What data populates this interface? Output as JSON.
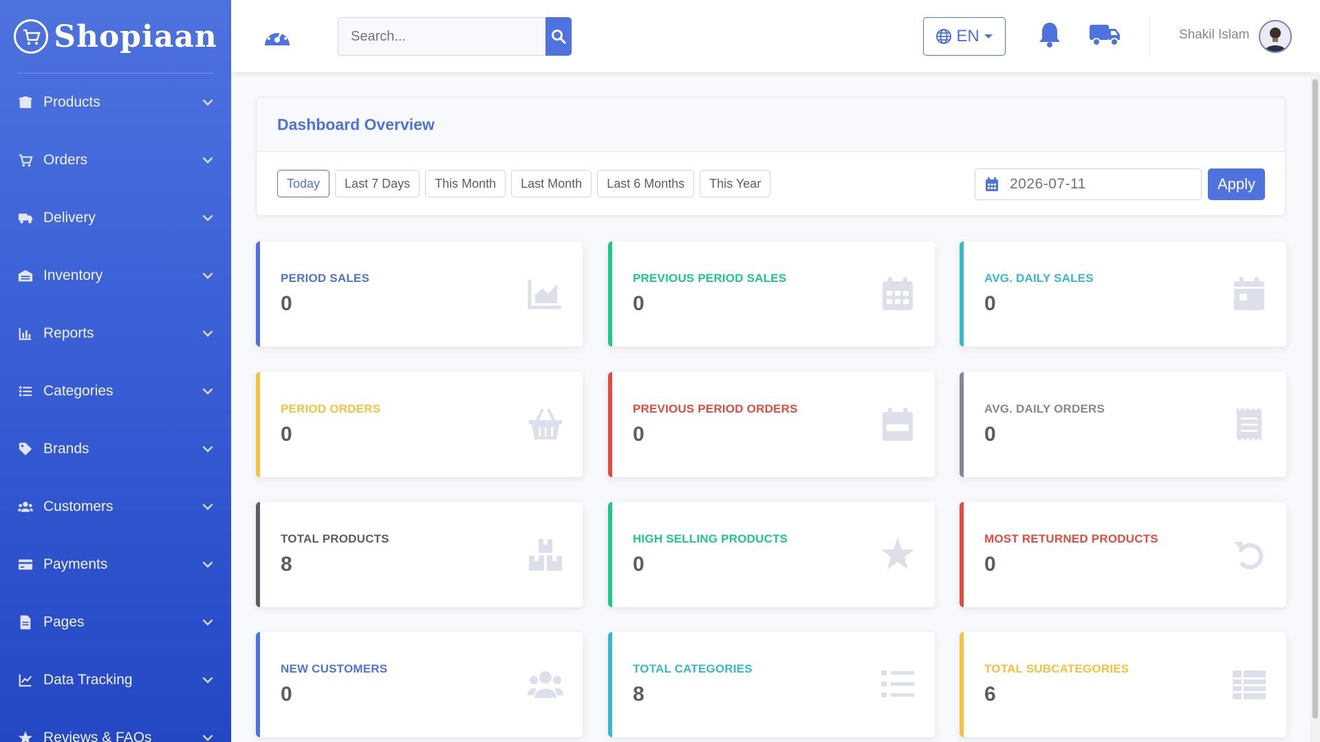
{
  "brand": {
    "name": "Shopiaan"
  },
  "sidebar": {
    "items": [
      {
        "label": "Products",
        "icon": "box-icon"
      },
      {
        "label": "Orders",
        "icon": "cart-icon"
      },
      {
        "label": "Delivery",
        "icon": "truck-icon"
      },
      {
        "label": "Inventory",
        "icon": "warehouse-icon"
      },
      {
        "label": "Reports",
        "icon": "bar-chart-icon"
      },
      {
        "label": "Categories",
        "icon": "list-icon"
      },
      {
        "label": "Brands",
        "icon": "tag-icon"
      },
      {
        "label": "Customers",
        "icon": "users-icon"
      },
      {
        "label": "Payments",
        "icon": "credit-card-icon"
      },
      {
        "label": "Pages",
        "icon": "file-icon"
      },
      {
        "label": "Data Tracking",
        "icon": "line-chart-icon"
      },
      {
        "label": "Reviews & FAQs",
        "icon": "star-icon"
      }
    ]
  },
  "topbar": {
    "search_placeholder": "Search...",
    "language": "EN",
    "user_name": "Shakil Islam"
  },
  "overview": {
    "title": "Dashboard Overview",
    "filters": [
      "Today",
      "Last 7 Days",
      "This Month",
      "Last Month",
      "Last 6 Months",
      "This Year"
    ],
    "active_filter": "Today",
    "date_value": "2026-07-11",
    "apply_label": "Apply"
  },
  "stats": [
    {
      "label": "PERIOD SALES",
      "value": "0",
      "color": "#4e73df",
      "icon": "chart-area-icon"
    },
    {
      "label": "PREVIOUS PERIOD SALES",
      "value": "0",
      "color": "#1cc88a",
      "icon": "calendar-grid-icon"
    },
    {
      "label": "AVG. DAILY SALES",
      "value": "0",
      "color": "#36b9cc",
      "icon": "calendar-day-icon"
    },
    {
      "label": "PERIOD ORDERS",
      "value": "0",
      "color": "#f6c23e",
      "icon": "basket-icon"
    },
    {
      "label": "PREVIOUS PERIOD ORDERS",
      "value": "0",
      "color": "#e74a3b",
      "icon": "calendar-week-icon"
    },
    {
      "label": "AVG. DAILY ORDERS",
      "value": "0",
      "color": "#858796",
      "icon": "receipt-icon"
    },
    {
      "label": "TOTAL PRODUCTS",
      "value": "8",
      "color": "#5a5c69",
      "icon": "boxes-icon"
    },
    {
      "label": "HIGH SELLING PRODUCTS",
      "value": "0",
      "color": "#1cc88a",
      "icon": "star-icon"
    },
    {
      "label": "MOST RETURNED PRODUCTS",
      "value": "0",
      "color": "#e74a3b",
      "icon": "undo-icon"
    },
    {
      "label": "NEW CUSTOMERS",
      "value": "0",
      "color": "#4e73df",
      "icon": "users-icon"
    },
    {
      "label": "TOTAL CATEGORIES",
      "value": "8",
      "color": "#36b9cc",
      "icon": "list-icon"
    },
    {
      "label": "TOTAL SUBCATEGORIES",
      "value": "6",
      "color": "#f6c23e",
      "icon": "table-icon"
    }
  ]
}
